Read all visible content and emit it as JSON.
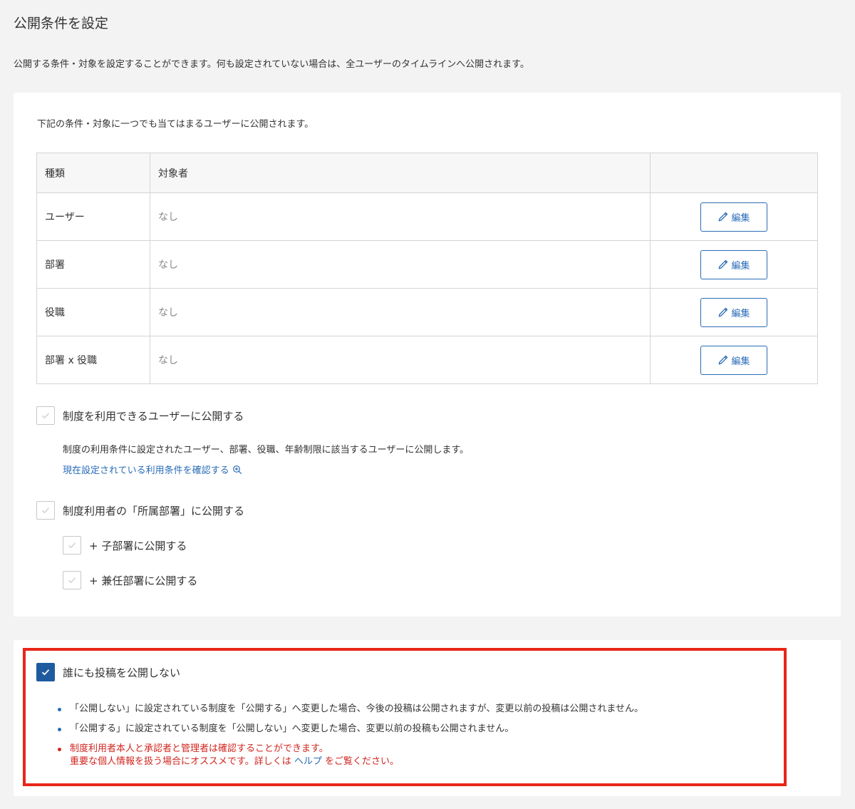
{
  "page": {
    "title": "公開条件を設定",
    "description": "公開する条件・対象を設定することができます。何も設定されていない場合は、全ユーザーのタイムラインへ公開されます。"
  },
  "conditions": {
    "intro": "下記の条件・対象に一つでも当てはまるユーザーに公開されます。",
    "table": {
      "headers": [
        "種類",
        "対象者",
        ""
      ],
      "rows": [
        {
          "type": "ユーザー",
          "target": "なし",
          "action": "編集"
        },
        {
          "type": "部署",
          "target": "なし",
          "action": "編集"
        },
        {
          "type": "役職",
          "target": "なし",
          "action": "編集"
        },
        {
          "type": "部署 x 役職",
          "target": "なし",
          "action": "編集"
        }
      ]
    },
    "options": {
      "eligible_users": {
        "label": "制度を利用できるユーザーに公開する",
        "checked": false,
        "description": "制度の利用条件に設定されたユーザー、部署、役職、年齢制限に該当するユーザーに公開します。",
        "link": "現在設定されている利用条件を確認する"
      },
      "department": {
        "label": "制度利用者の「所属部署」に公開する",
        "checked": false
      },
      "child_department": {
        "label": "+ 子部署に公開する",
        "checked": false
      },
      "concurrent_department": {
        "label": "+ 兼任部署に公開する",
        "checked": false
      }
    }
  },
  "private": {
    "label": "誰にも投稿を公開しない",
    "checked": true,
    "notes": [
      "「公開しない」に設定されている制度を「公開する」へ変更した場合、今後の投稿は公開されますが、変更以前の投稿は公開されません。",
      "「公開する」に設定されている制度を「公開しない」へ変更した場合、変更以前の投稿も公開されません。"
    ],
    "warning_line1": "制度利用者本人と承認者と管理者は確認することができます。",
    "warning_line2_before": "重要な個人情報を扱う場合にオススメです。詳しくは ",
    "warning_link": "ヘルプ",
    "warning_line2_after": " をご覧ください。"
  },
  "colors": {
    "accent": "#2a6cb7",
    "checked_bg": "#1f5a9e",
    "highlight_frame": "#e8261a",
    "warning_text": "#d0261f"
  },
  "icons": {
    "edit": "pencil-icon",
    "check": "check-icon",
    "zoom": "zoom-in-icon"
  }
}
